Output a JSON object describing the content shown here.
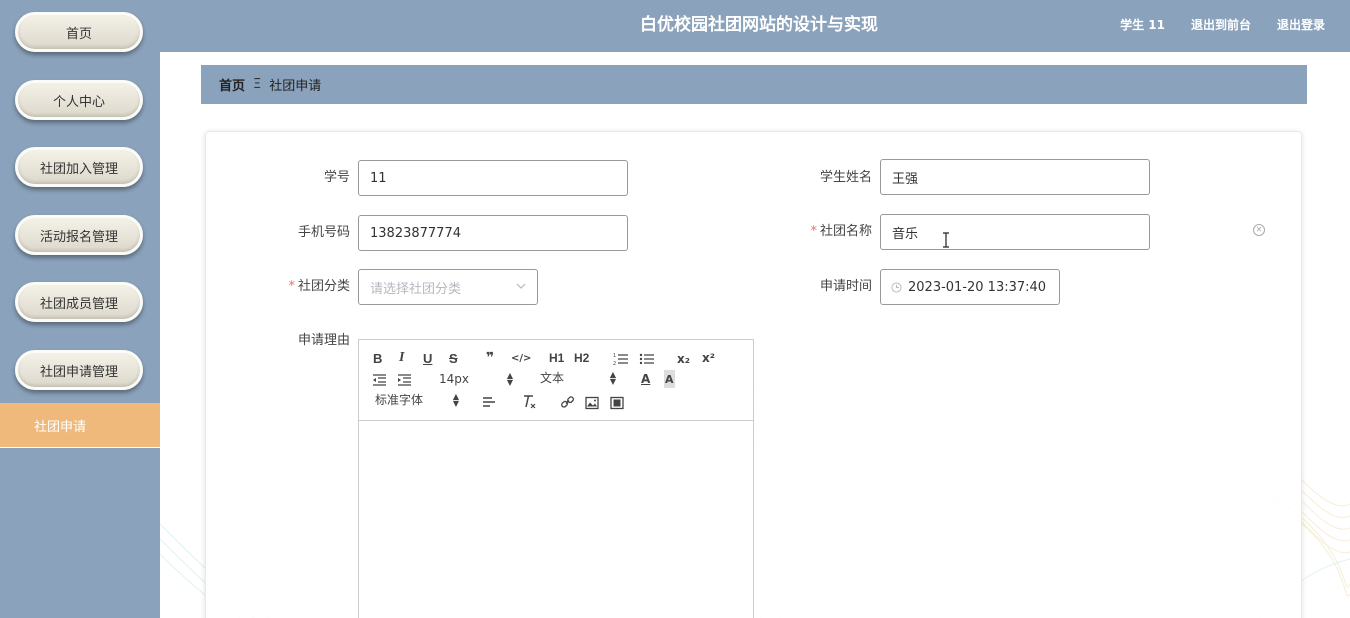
{
  "header": {
    "title": "白优校园社团网站的设计与实现",
    "user": "学生 11",
    "back_to_front": "退出到前台",
    "logout": "退出登录"
  },
  "sidebar": {
    "items": [
      {
        "label": "首页"
      },
      {
        "label": "个人中心"
      },
      {
        "label": "社团加入管理"
      },
      {
        "label": "活动报名管理"
      },
      {
        "label": "社团成员管理"
      },
      {
        "label": "社团申请管理"
      }
    ],
    "active": {
      "label": "社团申请"
    }
  },
  "breadcrumb": {
    "home": "首页",
    "separator": "Ξ",
    "current": "社团申请"
  },
  "form": {
    "student_id": {
      "label": "学号",
      "value": "11"
    },
    "student_name": {
      "label": "学生姓名",
      "value": "王强"
    },
    "phone": {
      "label": "手机号码",
      "value": "13823877774"
    },
    "club_name": {
      "label": "社团名称",
      "required_mark": "*",
      "value": "音乐"
    },
    "club_category": {
      "label": "社团分类",
      "required_mark": "*",
      "placeholder": "请选择社团分类"
    },
    "apply_time": {
      "label": "申请时间",
      "value": "2023-01-20 13:37:40"
    },
    "reason": {
      "label": "申请理由"
    }
  },
  "editor": {
    "bold": "B",
    "italic": "I",
    "underline": "U",
    "strike": "S",
    "quote": "❞",
    "code": "</>",
    "h1": "H1",
    "h2": "H2",
    "subscript": "x₂",
    "superscript": "x²",
    "size": "14px",
    "header_picker": "文本",
    "font_picker": "标准字体",
    "text_color": "A",
    "bg_color": "A"
  },
  "colors": {
    "sidebar_bg": "#8aa2bb",
    "active_bg": "#f0b97c",
    "required": "#f56c6c"
  }
}
